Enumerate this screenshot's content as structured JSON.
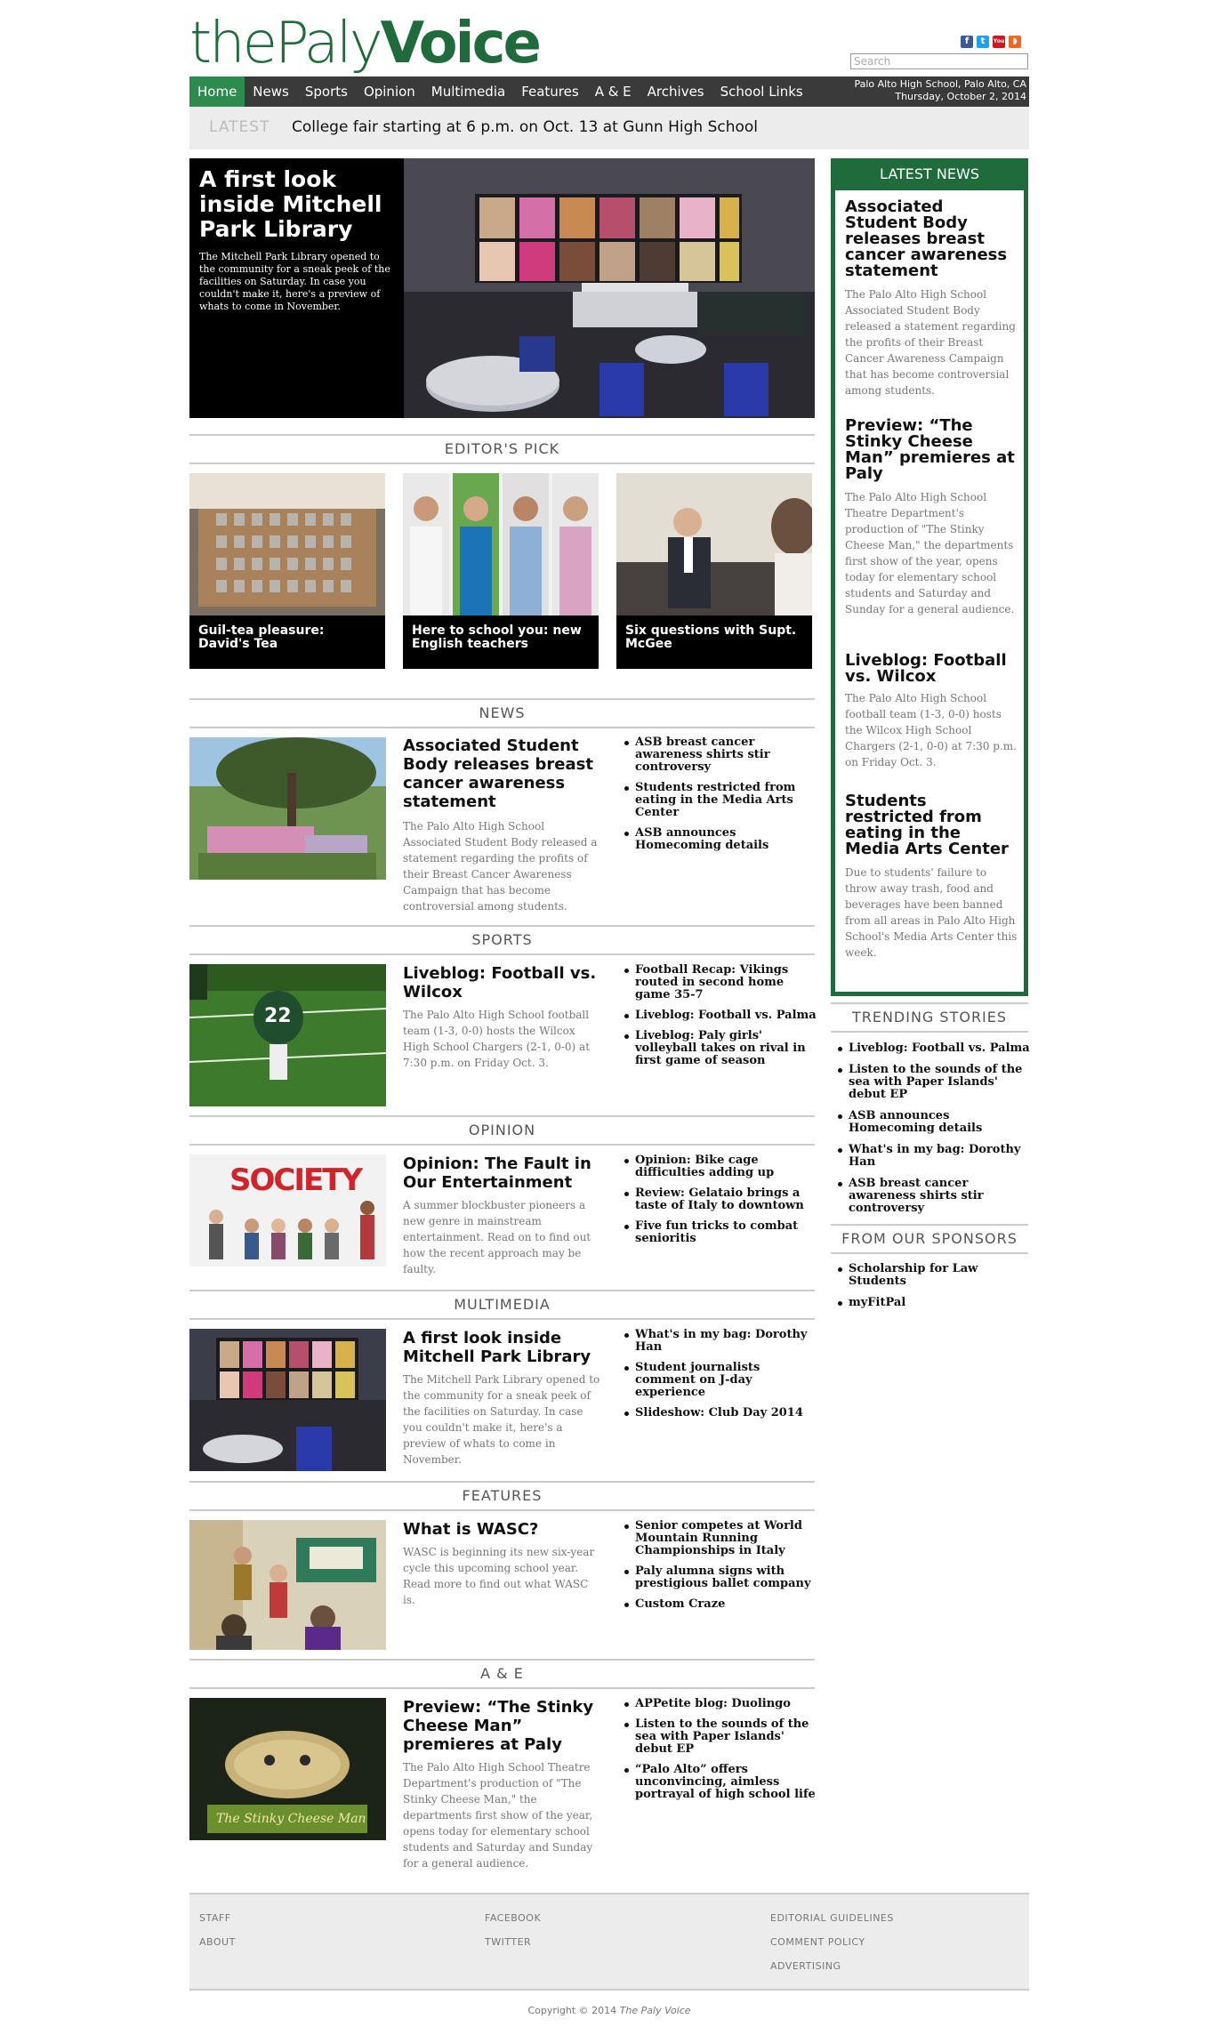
{
  "header": {
    "logo_part1": "the",
    "logo_part2": "Paly",
    "logo_part3": "Voice",
    "search_placeholder": "Search",
    "social": [
      {
        "icon": "facebook-icon",
        "label": "f",
        "color": "#3b5998"
      },
      {
        "icon": "twitter-icon",
        "label": "t",
        "color": "#1da1f2"
      },
      {
        "icon": "youtube-icon",
        "label": "You",
        "color": "#cc181e"
      },
      {
        "icon": "rss-icon",
        "label": "◗",
        "color": "#f26522"
      }
    ]
  },
  "nav": {
    "items": [
      "Home",
      "News",
      "Sports",
      "Opinion",
      "Multimedia",
      "Features",
      "A & E",
      "Archives",
      "School Links"
    ],
    "location": "Palo Alto High School, Palo Alto, CA",
    "date": "Thursday, October 2, 2014"
  },
  "latest": {
    "label": "LATEST",
    "text": "College fair starting at 6 p.m. on Oct. 13 at Gunn High School"
  },
  "hero": {
    "title": "A first look inside Mitchell Park Library",
    "desc": "The Mitchell Park Library opened to the community for a sneak peek of the facilities on Saturday. In case you couldn't make it, here's a preview of whats to come in November."
  },
  "editors_pick": {
    "heading": "EDITOR'S PICK",
    "items": [
      {
        "caption": "Guil-tea pleasure: David's Tea"
      },
      {
        "caption": "Here to school you: new English teachers"
      },
      {
        "caption": "Six questions with Supt. McGee"
      }
    ]
  },
  "sections": [
    {
      "heading": "NEWS",
      "title": "Associated Student Body releases breast cancer awareness statement",
      "desc": "The Palo Alto High School Associated Student Body released a statement regarding the profits of their Breast Cancer Awareness Campaign that has become controversial among students.",
      "related": [
        "ASB breast cancer awareness shirts stir controversy",
        "Students restricted from eating in the Media Arts Center",
        "ASB announces Homecoming details"
      ]
    },
    {
      "heading": "SPORTS",
      "title": "Liveblog: Football vs. Wilcox",
      "desc": "The Palo Alto High School football team (1-3, 0-0) hosts the Wilcox High School Chargers (2-1, 0-0) at 7:30 p.m. on Friday Oct. 3.",
      "related": [
        "Football Recap: Vikings routed in second home game 35-7",
        "Liveblog: Football vs. Palma",
        "Liveblog: Paly girls' volleyball takes on rival in first game of season"
      ]
    },
    {
      "heading": "OPINION",
      "title": "Opinion: The Fault in Our Entertainment",
      "desc": "A summer blockbuster pioneers a new genre in mainstream entertainment. Read on to find out how the recent approach may be faulty.",
      "related": [
        "Opinion: Bike cage difficulties adding up",
        "Review: Gelataio brings a taste of Italy to downtown",
        "Five fun tricks to combat senioritis"
      ],
      "thumb_text": "SOCIETY"
    },
    {
      "heading": "MULTIMEDIA",
      "title": "A first look inside Mitchell Park Library",
      "desc": "The Mitchell Park Library opened to the community for a sneak peek of the facilities on Saturday. In case you couldn't make it, here's a preview of whats to come in November.",
      "related": [
        "What's in my bag: Dorothy Han",
        "Student journalists comment on J-day experience",
        "Slideshow: Club Day 2014"
      ]
    },
    {
      "heading": "FEATURES",
      "title": "What is WASC?",
      "desc": "WASC is beginning its new six-year cycle this upcoming school year. Read more to find out what WASC is.",
      "related": [
        "Senior competes at World Mountain Running Championships in Italy",
        "Paly alumna signs with prestigious ballet company",
        "Custom Craze"
      ]
    },
    {
      "heading": "A & E",
      "title": "Preview: “The Stinky Cheese Man” premieres at Paly",
      "desc": "The Palo Alto High School Theatre Department's production of \"The Stinky Cheese Man,\" the departments first show of the year, opens today for elementary school students and Saturday and Sunday for a general audience.",
      "related": [
        "APPetite blog: Duolingo",
        "Listen to the sounds of the sea with Paper Islands' debut EP",
        "“Palo Alto” offers unconvincing, aimless portrayal of high school life"
      ],
      "thumb_text": "The Stinky Cheese Man"
    }
  ],
  "sidebar": {
    "latest_heading": "LATEST NEWS",
    "latest": [
      {
        "title": "Associated Student Body releases breast cancer awareness statement",
        "desc": "The Palo Alto High School Associated Student Body released a statement regarding the profits of their Breast Cancer Awareness Campaign that has become controversial among students."
      },
      {
        "title": "Preview: “The Stinky Cheese Man” premieres at Paly",
        "desc": "The Palo Alto High School Theatre Department's production of \"The Stinky Cheese Man,\" the departments first show of the year, opens today for elementary school students and Saturday and Sunday for a general audience."
      },
      {
        "title": "Liveblog: Football vs. Wilcox",
        "desc": "The Palo Alto High School football team (1-3, 0-0) hosts the Wilcox High School Chargers (2-1, 0-0) at 7:30 p.m. on Friday Oct. 3."
      },
      {
        "title": "Students restricted from eating in the Media Arts Center",
        "desc": "Due to students' failure to throw away trash, food and beverages have been banned from all areas in Palo Alto High School's Media Arts Center this week."
      }
    ],
    "trending_heading": "TRENDING STORIES",
    "trending": [
      "Liveblog: Football vs. Palma",
      "Listen to the sounds of the sea with Paper Islands' debut EP",
      "ASB announces Homecoming details",
      "What's in my bag: Dorothy Han",
      "ASB breast cancer awareness shirts stir controversy"
    ],
    "sponsors_heading": "FROM OUR SPONSORS",
    "sponsors": [
      "Scholarship for Law Students",
      "myFitPal"
    ]
  },
  "footer": {
    "links": [
      "STAFF",
      "ABOUT",
      "FACEBOOK",
      "TWITTER",
      "EDITORIAL GUIDELINES",
      "COMMENT POLICY",
      "ADVERTISING"
    ],
    "copyright": "Copyright © 2014",
    "copyright_italic": "The Paly Voice"
  }
}
